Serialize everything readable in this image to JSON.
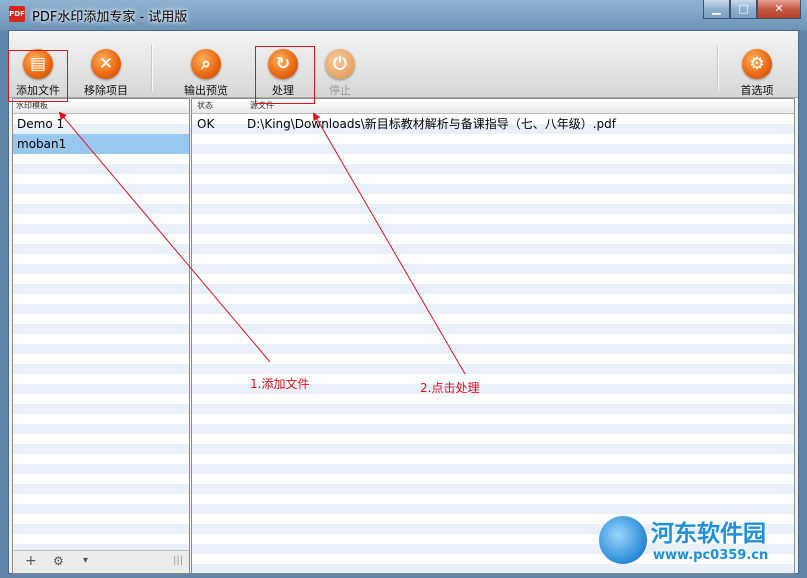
{
  "window": {
    "title": "PDF水印添加专家 - 试用版",
    "icon": "pdf-icon",
    "controls": [
      "minimize-icon",
      "maximize-icon",
      "close-icon"
    ]
  },
  "toolbar": {
    "add_file": {
      "label": "添加文件",
      "icon": "add-file-icon"
    },
    "remove_item": {
      "label": "移除项目",
      "icon": "remove-icon"
    },
    "preview": {
      "label": "输出预览",
      "icon": "preview-icon"
    },
    "process": {
      "label": "处理",
      "icon": "process-icon"
    },
    "stop": {
      "label": "停止",
      "icon": "stop-icon",
      "disabled": true
    },
    "preferences": {
      "label": "首选项",
      "icon": "preferences-icon"
    }
  },
  "templates": {
    "header": "水印模板",
    "items": [
      {
        "label": "Demo 1",
        "selected": false
      },
      {
        "label": "moban1",
        "selected": true
      }
    ],
    "footer": {
      "add": "+",
      "settings": "⚙",
      "menu": "▾",
      "grip": "|||"
    }
  },
  "files": {
    "columns": [
      "状态",
      "源文件"
    ],
    "rows": [
      {
        "status": "OK",
        "path": "D:\\King\\Downloads\\新目标教材解析与备课指导（七、八年级）.pdf"
      }
    ]
  },
  "annotations": {
    "step1": "1.添加文件",
    "step2": "2.点击处理",
    "color": "#e0131b"
  },
  "watermark": {
    "name": "河东软件园",
    "url": "www.pc0359.cn"
  }
}
